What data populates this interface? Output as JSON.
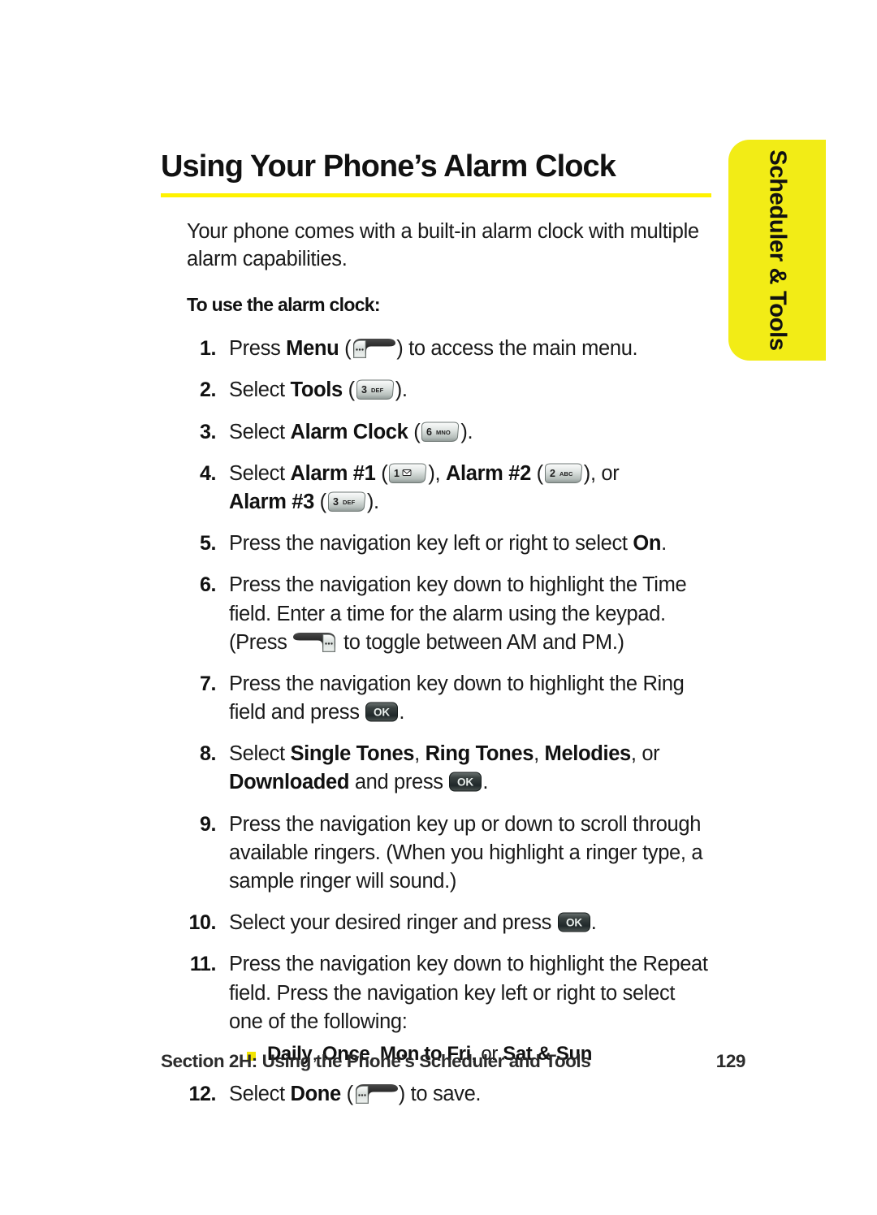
{
  "side_tab": {
    "label": "Scheduler & Tools",
    "color": "#f2ec16"
  },
  "header": {
    "title": "Using Your Phone’s Alarm Clock",
    "rule_color": "#fff200"
  },
  "intro": "Your phone comes with a built-in alarm clock with multiple alarm capabilities.",
  "subhead": "To use the alarm clock:",
  "steps": [
    {
      "number": "1.",
      "parts": [
        {
          "type": "text",
          "text": "Press "
        },
        {
          "type": "bold",
          "text": "Menu"
        },
        {
          "type": "text",
          "text": " ("
        },
        {
          "type": "icon",
          "icon": "softkey-left-icon"
        },
        {
          "type": "text",
          "text": ") to access the main menu."
        }
      ]
    },
    {
      "number": "2.",
      "parts": [
        {
          "type": "text",
          "text": "Select "
        },
        {
          "type": "bold",
          "text": "Tools"
        },
        {
          "type": "text",
          "text": " ("
        },
        {
          "type": "icon",
          "icon": "key-3-def-icon"
        },
        {
          "type": "text",
          "text": ")."
        }
      ]
    },
    {
      "number": "3.",
      "parts": [
        {
          "type": "text",
          "text": "Select "
        },
        {
          "type": "bold",
          "text": "Alarm Clock"
        },
        {
          "type": "text",
          "text": " ("
        },
        {
          "type": "icon",
          "icon": "key-6-mno-icon"
        },
        {
          "type": "text",
          "text": ")."
        }
      ]
    },
    {
      "number": "4.",
      "parts": [
        {
          "type": "text",
          "text": "Select "
        },
        {
          "type": "bold",
          "text": "Alarm #1"
        },
        {
          "type": "text",
          "text": " ("
        },
        {
          "type": "icon",
          "icon": "key-1-envelope-icon"
        },
        {
          "type": "text",
          "text": "), "
        },
        {
          "type": "bold",
          "text": "Alarm #2"
        },
        {
          "type": "text",
          "text": " ("
        },
        {
          "type": "icon",
          "icon": "key-2-abc-icon"
        },
        {
          "type": "text",
          "text": "), or"
        },
        {
          "type": "break"
        },
        {
          "type": "bold",
          "text": "Alarm #3"
        },
        {
          "type": "text",
          "text": " ("
        },
        {
          "type": "icon",
          "icon": "key-3-def-icon"
        },
        {
          "type": "text",
          "text": ")."
        }
      ]
    },
    {
      "number": "5.",
      "parts": [
        {
          "type": "text",
          "text": "Press the navigation key left or right to select "
        },
        {
          "type": "bold",
          "text": "On"
        },
        {
          "type": "text",
          "text": "."
        }
      ]
    },
    {
      "number": "6.",
      "parts": [
        {
          "type": "text",
          "text": "Press the navigation key down to highlight the Time field. Enter a time for the alarm using the keypad. (Press "
        },
        {
          "type": "icon",
          "icon": "softkey-right-icon"
        },
        {
          "type": "text",
          "text": " to toggle between AM and PM.)"
        }
      ]
    },
    {
      "number": "7.",
      "parts": [
        {
          "type": "text",
          "text": "Press the navigation key down to highlight the Ring field and press "
        },
        {
          "type": "icon",
          "icon": "ok-button-icon"
        },
        {
          "type": "text",
          "text": "."
        }
      ]
    },
    {
      "number": "8.",
      "parts": [
        {
          "type": "text",
          "text": "Select "
        },
        {
          "type": "bold",
          "text": "Single Tones"
        },
        {
          "type": "text",
          "text": ", "
        },
        {
          "type": "bold",
          "text": "Ring Tones"
        },
        {
          "type": "text",
          "text": ", "
        },
        {
          "type": "bold",
          "text": "Melodies"
        },
        {
          "type": "text",
          "text": ", or "
        },
        {
          "type": "bold",
          "text": "Downloaded"
        },
        {
          "type": "text",
          "text": " and press "
        },
        {
          "type": "icon",
          "icon": "ok-button-icon"
        },
        {
          "type": "text",
          "text": "."
        }
      ]
    },
    {
      "number": "9.",
      "parts": [
        {
          "type": "text",
          "text": "Press the navigation key up or down to scroll through available ringers. (When you highlight a ringer type, a sample ringer will sound.)"
        }
      ]
    },
    {
      "number": "10.",
      "parts": [
        {
          "type": "text",
          "text": "Select your desired ringer and press "
        },
        {
          "type": "icon",
          "icon": "ok-button-icon"
        },
        {
          "type": "text",
          "text": "."
        }
      ]
    },
    {
      "number": "11.",
      "parts": [
        {
          "type": "text",
          "text": "Press the navigation key down to highlight the Repeat field. Press the navigation key left or right to select one of the following:"
        }
      ],
      "sub_bullets": [
        {
          "parts": [
            {
              "type": "bold",
              "text": "Daily"
            },
            {
              "type": "text",
              "text": ", "
            },
            {
              "type": "bold",
              "text": "Once"
            },
            {
              "type": "text",
              "text": ", "
            },
            {
              "type": "bold",
              "text": "Mon to Fri"
            },
            {
              "type": "text",
              "text": ", or "
            },
            {
              "type": "bold",
              "text": "Sat & Sun"
            }
          ]
        }
      ]
    },
    {
      "number": "12.",
      "parts": [
        {
          "type": "text",
          "text": "Select "
        },
        {
          "type": "bold",
          "text": "Done"
        },
        {
          "type": "text",
          "text": " ("
        },
        {
          "type": "icon",
          "icon": "softkey-left-icon"
        },
        {
          "type": "text",
          "text": ") to save."
        }
      ]
    }
  ],
  "icons": {
    "key-3-def-icon": {
      "digit": "3",
      "letters": "DEF"
    },
    "key-6-mno-icon": {
      "digit": "6",
      "letters": "MNO"
    },
    "key-1-envelope-icon": {
      "digit": "1",
      "letters": ""
    },
    "key-2-abc-icon": {
      "digit": "2",
      "letters": "ABC"
    },
    "ok-button-icon": {
      "label": "OK"
    }
  },
  "footer": {
    "section": "Section 2H: Using the Phone’s Scheduler and Tools",
    "page_number": "129"
  }
}
